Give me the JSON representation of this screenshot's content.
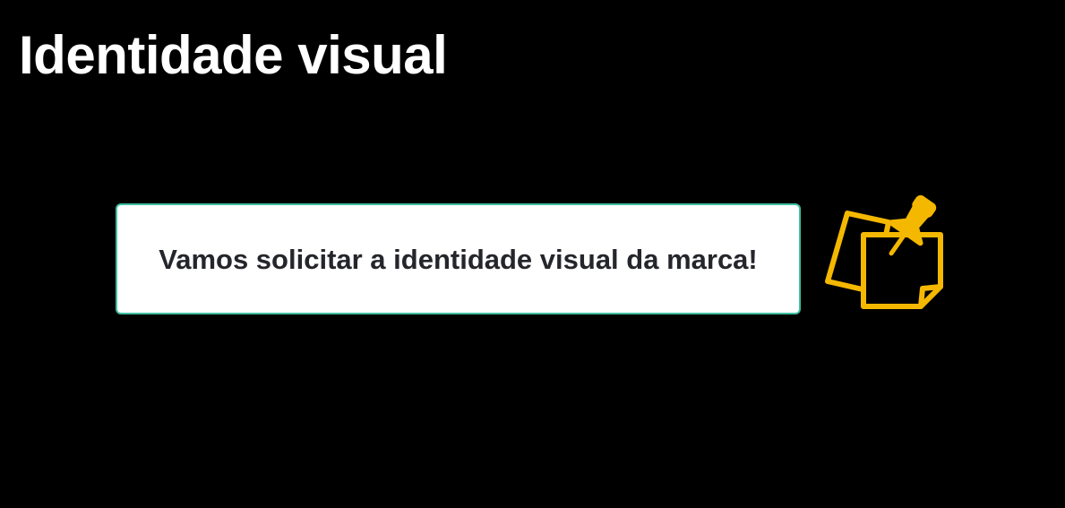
{
  "slide": {
    "title": "Identidade visual",
    "message": "Vamos solicitar a identidade visual da marca!",
    "icon": "pinned-sticky-notes-icon"
  },
  "colors": {
    "background": "#000000",
    "title": "#ffffff",
    "card_background": "#ffffff",
    "card_border": "#3fbfa0",
    "message_text": "#25262b",
    "icon_accent": "#f5b800"
  }
}
